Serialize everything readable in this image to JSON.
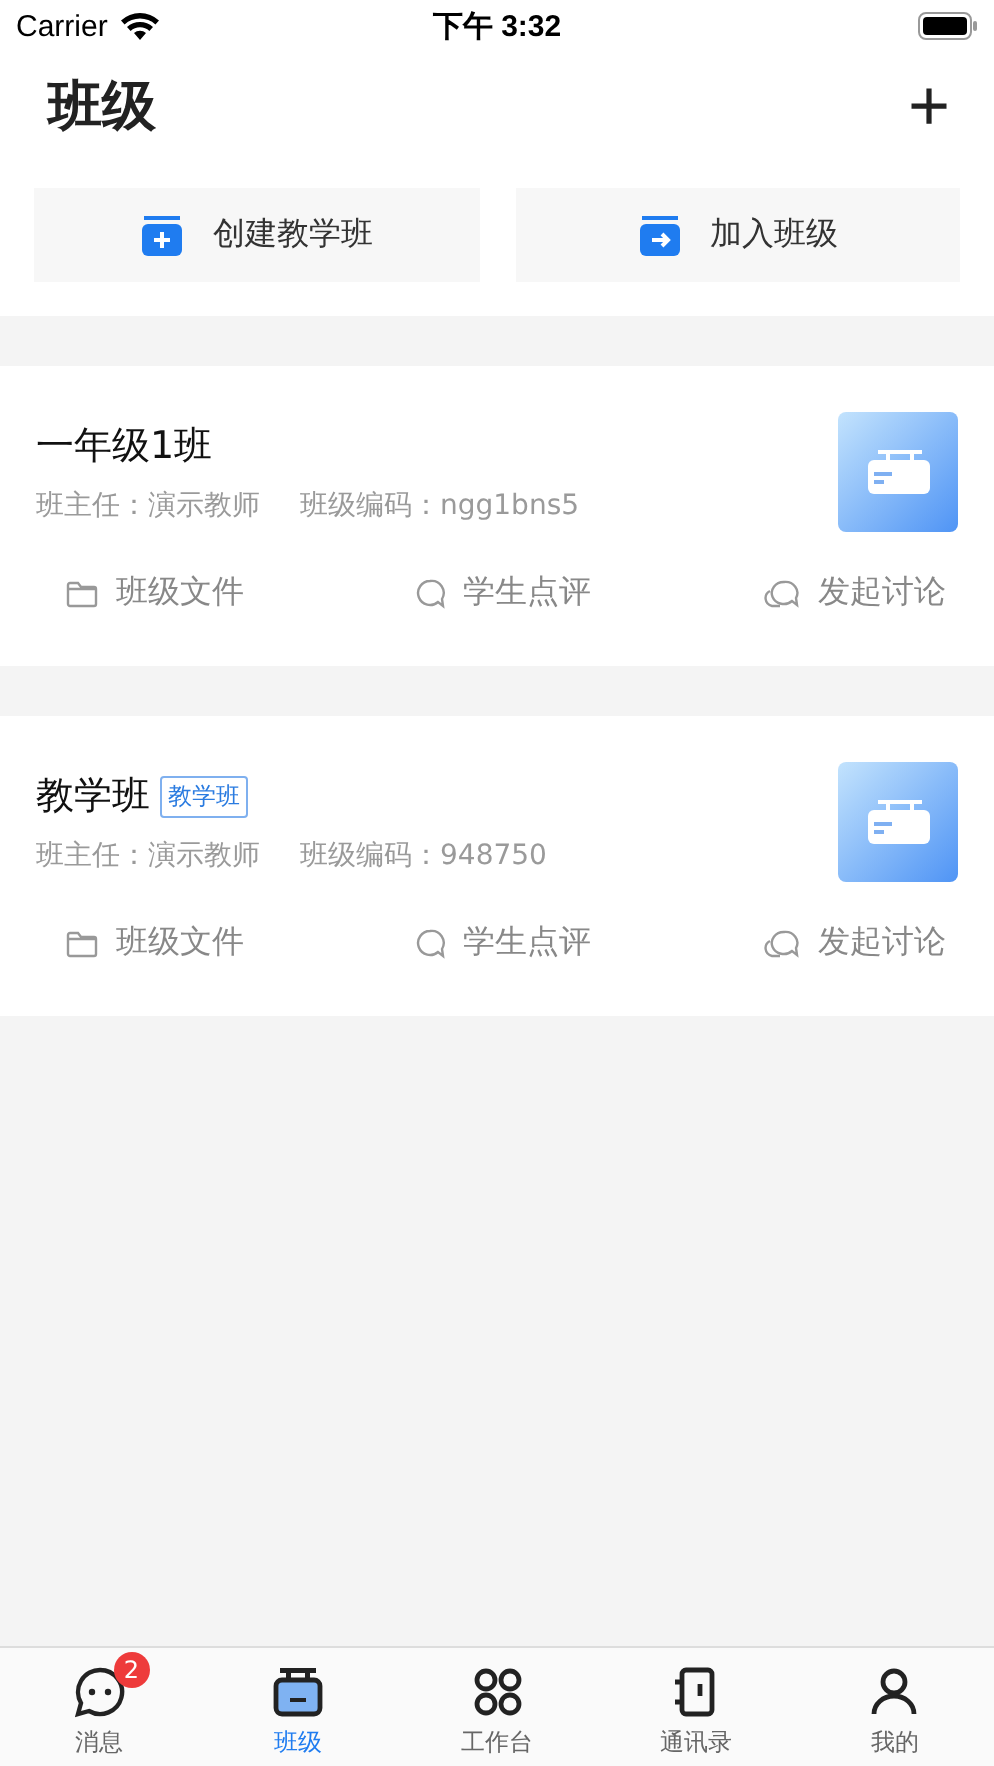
{
  "status_bar": {
    "carrier": "Carrier",
    "time": "下午 3:32"
  },
  "header": {
    "title": "班级",
    "add": "+"
  },
  "actions": [
    {
      "kind": "create",
      "label": "创建教学班"
    },
    {
      "kind": "join",
      "label": "加入班级"
    }
  ],
  "classes": [
    {
      "name": "一年级1班",
      "teacher": "班主任：演示教师",
      "code": "班级编码：ngg1bns5",
      "links": [
        {
          "kind": "folder",
          "label": "班级文件"
        },
        {
          "kind": "comment",
          "label": "学生点评"
        },
        {
          "kind": "discuss",
          "label": "发起讨论"
        }
      ]
    },
    {
      "name": "教学班",
      "tag": "教学班",
      "teacher": "班主任：演示教师",
      "code": "班级编码：948750",
      "links": [
        {
          "kind": "folder",
          "label": "班级文件"
        },
        {
          "kind": "comment",
          "label": "学生点评"
        },
        {
          "kind": "discuss",
          "label": "发起讨论"
        }
      ]
    }
  ],
  "tab_bar": [
    {
      "kind": "chat",
      "label": "消息",
      "badge": "2",
      "selected": false
    },
    {
      "kind": "class",
      "label": "班级",
      "selected": true
    },
    {
      "kind": "grid",
      "label": "工作台",
      "selected": false
    },
    {
      "kind": "contacts",
      "label": "通讯录",
      "selected": false
    },
    {
      "kind": "me",
      "label": "我的",
      "selected": false
    }
  ]
}
